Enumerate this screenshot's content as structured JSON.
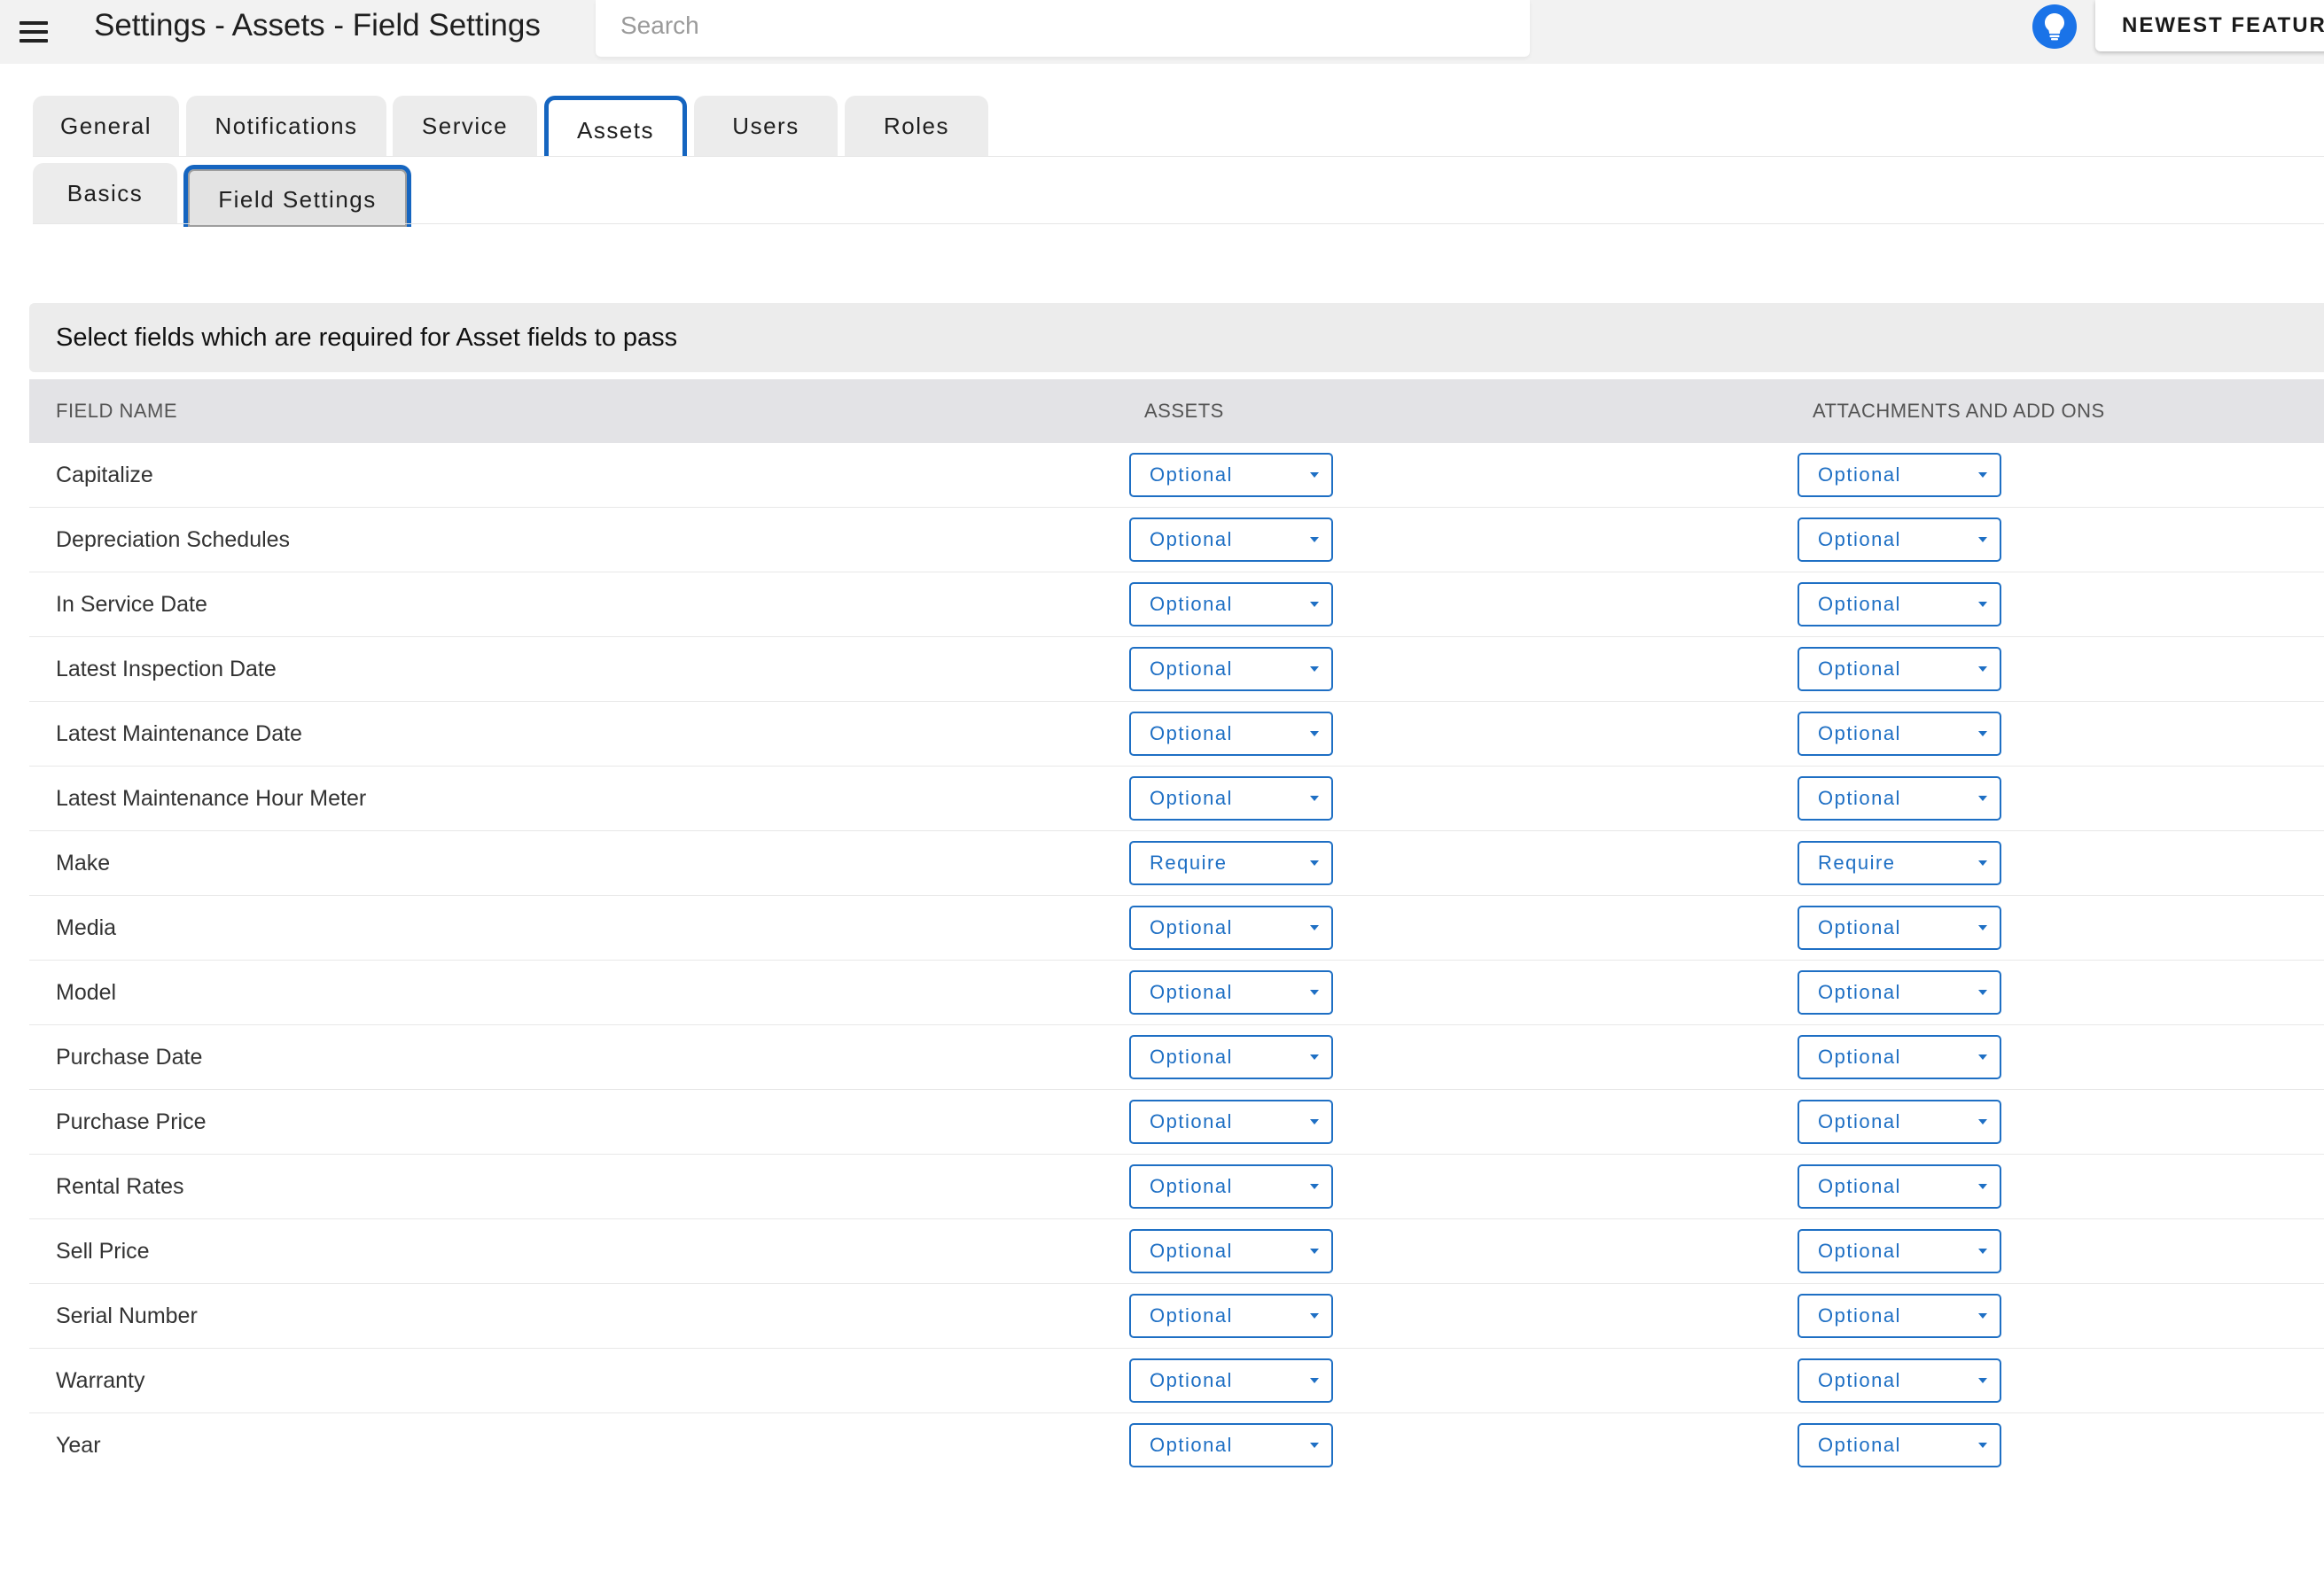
{
  "header": {
    "title": "Settings - Assets - Field Settings",
    "search_placeholder": "Search",
    "newest_label": "NEWEST FEATURES"
  },
  "tabs": [
    "General",
    "Notifications",
    "Service",
    "Assets",
    "Users",
    "Roles"
  ],
  "active_tab": "Assets",
  "subtabs": [
    "Basics",
    "Field Settings"
  ],
  "active_subtab": "Field Settings",
  "section": {
    "title": "Select fields which are required for Asset fields to pass"
  },
  "table": {
    "headers": [
      "FIELD NAME",
      "ASSETS",
      "ATTACHMENTS AND ADD ONS"
    ],
    "rows": [
      {
        "name": "Capitalize",
        "assets": "Optional",
        "attachments": "Optional"
      },
      {
        "name": "Depreciation Schedules",
        "assets": "Optional",
        "attachments": "Optional"
      },
      {
        "name": "In Service Date",
        "assets": "Optional",
        "attachments": "Optional"
      },
      {
        "name": "Latest Inspection Date",
        "assets": "Optional",
        "attachments": "Optional"
      },
      {
        "name": "Latest Maintenance Date",
        "assets": "Optional",
        "attachments": "Optional"
      },
      {
        "name": "Latest Maintenance Hour Meter",
        "assets": "Optional",
        "attachments": "Optional"
      },
      {
        "name": "Make",
        "assets": "Require",
        "attachments": "Require"
      },
      {
        "name": "Media",
        "assets": "Optional",
        "attachments": "Optional"
      },
      {
        "name": "Model",
        "assets": "Optional",
        "attachments": "Optional"
      },
      {
        "name": "Purchase Date",
        "assets": "Optional",
        "attachments": "Optional"
      },
      {
        "name": "Purchase Price",
        "assets": "Optional",
        "attachments": "Optional"
      },
      {
        "name": "Rental Rates",
        "assets": "Optional",
        "attachments": "Optional"
      },
      {
        "name": "Sell Price",
        "assets": "Optional",
        "attachments": "Optional"
      },
      {
        "name": "Serial Number",
        "assets": "Optional",
        "attachments": "Optional"
      },
      {
        "name": "Warranty",
        "assets": "Optional",
        "attachments": "Optional"
      },
      {
        "name": "Year",
        "assets": "Optional",
        "attachments": "Optional"
      }
    ]
  },
  "colors": {
    "accent": "#1565c0",
    "dropdown_text": "#1e6fc4",
    "bulb": "#1a73e8"
  },
  "icons": {
    "menu": "hamburger-menu-icon",
    "bulb": "lightbulb-icon",
    "dropdown": "caret-down-icon"
  }
}
